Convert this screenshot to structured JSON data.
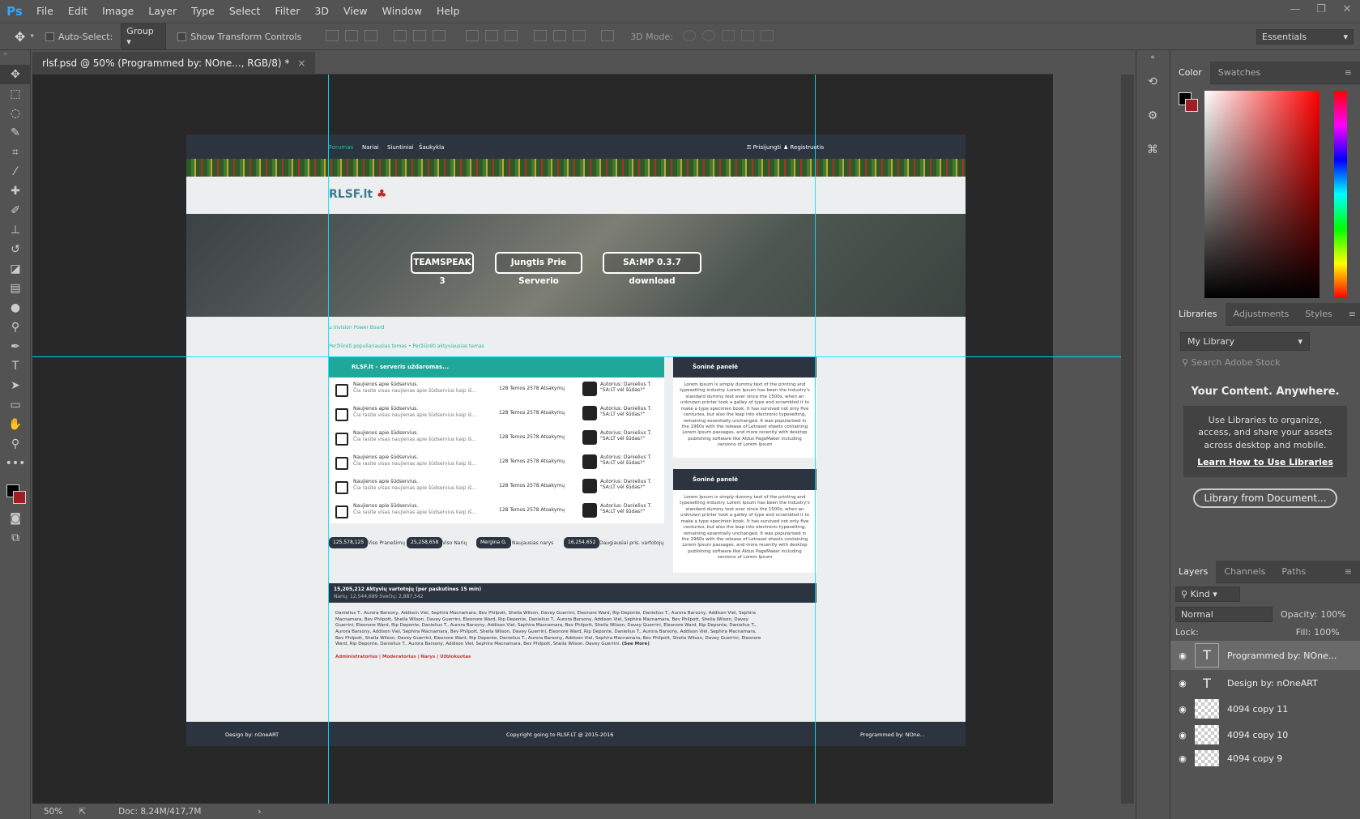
{
  "app": {
    "logo": "Ps"
  },
  "menu": [
    "File",
    "Edit",
    "Image",
    "Layer",
    "Type",
    "Select",
    "Filter",
    "3D",
    "View",
    "Window",
    "Help"
  ],
  "options_bar": {
    "auto_select_label": "Auto-Select:",
    "auto_select_value": "Group",
    "show_transform_label": "Show Transform Controls",
    "mode_3d_label": "3D Mode:",
    "workspace": "Essentials"
  },
  "document_tab": {
    "title": "rlsf.psd @ 50% (Programmed by: NOne..., RGB/8) *",
    "close": "×"
  },
  "status": {
    "zoom": "50%",
    "doc": "Doc: 8,24M/417,7M"
  },
  "panels": {
    "color_tabs": [
      "Color",
      "Swatches"
    ],
    "libraries_tabs": [
      "Libraries",
      "Adjustments",
      "Styles"
    ],
    "library_select": "My Library",
    "search_placeholder": "Search Adobe Stock",
    "lib_heading": "Your Content. Anywhere.",
    "lib_text": "Use Libraries to organize, access, and share your assets across desktop and mobile.",
    "lib_link": "Learn How to Use Libraries",
    "lib_button": "Library from Document...",
    "layers_tabs": [
      "Layers",
      "Channels",
      "Paths"
    ],
    "kind": "Kind",
    "blend": "Normal",
    "opacity_label": "Opacity:",
    "opacity": "100%",
    "lock_label": "Lock:",
    "fill_label": "Fill:",
    "fill": "100%",
    "layers": [
      {
        "name": "Programmed by: NOne...",
        "type": "text"
      },
      {
        "name": "Design by: nOneART",
        "type": "text"
      },
      {
        "name": "4094 copy 11",
        "type": "image"
      },
      {
        "name": "4094 copy 10",
        "type": "image"
      },
      {
        "name": "4094 copy 9",
        "type": "image"
      }
    ]
  },
  "site": {
    "nav": [
      "Forumas",
      "Nariai",
      "Siuntiniai",
      "Šaukykla"
    ],
    "login": "Prisijungti",
    "register": "Registruotis",
    "logo": "RLSF.lt",
    "hero_buttons": [
      "TEAMSPEAK 3",
      "Jungtis Prie Serverio",
      "SA:MP 0.3.7 download"
    ],
    "breadcrumb": "Invision Power Board",
    "sublinks": "Peržiūrėti populiariausias temas • Peržiūrėti aktyviausias temas",
    "forum_title": "RLSF.lt - serveris uždaromas...",
    "forum_rows": [
      {
        "title": "Naujienos apie šūdservius.",
        "desc": "Čia rasite visas naujienas apie šūdservius kaip iš...",
        "stats": "128 Temos     2578 Atsakymų",
        "author": "Autorius: Danielius T.",
        "sub": "\"SA:LT vėl šūdas?\""
      },
      {
        "title": "Naujienos apie šūdservius.",
        "desc": "Čia rasite visas naujienas apie šūdservius kaip iš...",
        "stats": "128 Temos     2578 Atsakymų",
        "author": "Autorius: Danielius T.",
        "sub": "\"SA:LT vėl šūdas?\""
      },
      {
        "title": "Naujienos apie šūdservius.",
        "desc": "Čia rasite visas naujienas apie šūdservius kaip iš...",
        "stats": "128 Temos     2578 Atsakymų",
        "author": "Autorius: Danielius T.",
        "sub": "\"SA:LT vėl šūdas?\""
      },
      {
        "title": "Naujienos apie šūdservius.",
        "desc": "Čia rasite visas naujienas apie šūdservius kaip iš...",
        "stats": "128 Temos     2578 Atsakymų",
        "author": "Autorius: Danielius T.",
        "sub": "\"SA:LT vėl šūdas?\""
      },
      {
        "title": "Naujienos apie šūdservius.",
        "desc": "Čia rasite visas naujienas apie šūdservius kaip iš...",
        "stats": "128 Temos     2578 Atsakymų",
        "author": "Autorius: Danielius T.",
        "sub": "\"SA:LT vėl šūdas?\""
      },
      {
        "title": "Naujienos apie šūdservius.",
        "desc": "Čia rasite visas naujienas apie šūdservius kaip iš...",
        "stats": "128 Temos     2578 Atsakymų",
        "author": "Autorius: Danielius T.",
        "sub": "\"SA:LT vėl šūdas?\""
      }
    ],
    "stats": [
      {
        "value": "125,578,125",
        "label": "Viso Pranešimų"
      },
      {
        "value": "25,258,658",
        "label": "Viso Narių"
      },
      {
        "value": "Mergina G.",
        "label": "Naujausias narys"
      },
      {
        "value": "16,254,652",
        "label": "Daugiausiai pris. vartotojų"
      }
    ],
    "side_title": "Šoninė panelė",
    "side_text": "Lorem Ipsum is simply dummy text of the printing and typesetting industry. Lorem Ipsum has been the industry's standard dummy text ever since the 1500s, when an unknown printer took a galley of type and scrambled it to make a type specimen book. It has survived not only five centuries, but also the leap into electronic typesetting, remaining essentially unchanged. It was popularised in the 1960s with the release of Letraset sheets containing Lorem Ipsum passages, and more recently with desktop publishing software like Aldus PageMaker including versions of Lorem Ipsum",
    "online_title": "15,205,212 Aktyvių vartotojų (per paskutines 15 min)",
    "online_sub": "Narių: 12,544,689 Svečių: 2,887,542",
    "online_list": "Danielius T., Aurora Barsony, Addison Viel, Sephira Macnamara, Bev Philpott, Sheila Wilson, Davey Guerrini, Eleonore Ward, Rip Deponte, Danielius T., Aurora Barsony, Addison Viel, Sephira Macnamara, Bev Philpott, Sheila Wilson, Davey Guerrini, Eleonore Ward, Rip Deponte, Danielius T., Aurora Barsony, Addison Viel, Sephira Macnamara, Bev Philpott, Sheila Wilson, Davey Guerrini, Eleonore Ward, Rip Deponte, Danielius T., Aurora Barsony, Addison Viel, Sephira Macnamara, Bev Philpott, Sheila Wilson, Davey Guerrini, Eleonore Ward, Rip Deponte, Danielius T., Aurora Barsony, Addison Viel, Sephira Macnamara, Bev Philpott, Sheila Wilson, Davey Guerrini, Eleonore Ward, Rip Deponte, Danielius T., Aurora Barsony, Addison Viel, Sephira Macnamara, Bev Philpott, Sheila Wilson, Davey Guerrini, Eleonore Ward, Rip Deponte, Danielius T., Aurora Barsony, Addison Viel, Sephira Macnamara, Bev Philpott, Sheila Wilson, Davey Guerrini, Eleonore Ward, Rip Deponte, Danielius T., Aurora Barsony, Addison Viel, Sephira Macnamara, Bev Philpott, Sheila Wilson. Davey Guerrini.",
    "see_more": "(See More)",
    "groups": "Administratorius | Moderatorius | Narys | Užblokuotas",
    "footer_left": "Design by: nOneART",
    "footer_center": "Copyright going to RLSF.LT @ 2015-2016",
    "footer_right": "Programmed by: NOne..."
  }
}
